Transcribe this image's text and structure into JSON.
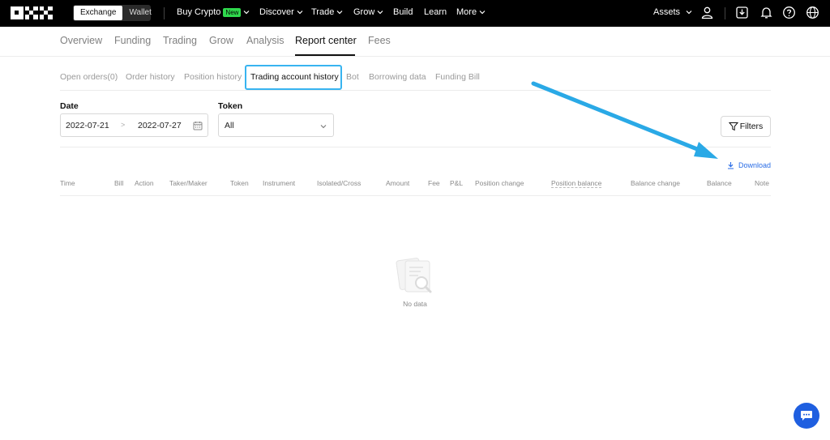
{
  "topbar": {
    "mode_options": [
      "Exchange",
      "Wallet"
    ],
    "nav": [
      {
        "label": "Buy Crypto",
        "badge": "New"
      },
      {
        "label": "Discover"
      },
      {
        "label": "Trade"
      },
      {
        "label": "Grow"
      },
      {
        "label": "Build"
      },
      {
        "label": "Learn"
      },
      {
        "label": "More"
      }
    ],
    "assets_label": "Assets"
  },
  "subnav": {
    "tabs": [
      "Overview",
      "Funding",
      "Trading",
      "Grow",
      "Analysis",
      "Report center",
      "Fees"
    ]
  },
  "report_tabs": [
    "Open orders(0)",
    "Order history",
    "Position history",
    "Trading account history",
    "Bot",
    "Borrowing data",
    "Funding Bill"
  ],
  "filters": {
    "date_label": "Date",
    "date_from": "2022-07-21",
    "date_sep": ">",
    "date_to": "2022-07-27",
    "token_label": "Token",
    "token_value": "All",
    "filters_button": "Filters"
  },
  "download_label": "Download",
  "table": {
    "columns": [
      "Time",
      "Bill",
      "Action",
      "Taker/Maker",
      "Token",
      "Instrument",
      "Isolated/Cross",
      "Amount",
      "Fee",
      "P&L",
      "Position change",
      "Position balance",
      "Balance change",
      "Balance",
      "Note"
    ]
  },
  "empty_text": "No data",
  "colors": {
    "accent": "#2a6de6",
    "highlight": "#38b4f0",
    "new_badge": "#2fd94d",
    "chat": "#1f5fe0"
  }
}
